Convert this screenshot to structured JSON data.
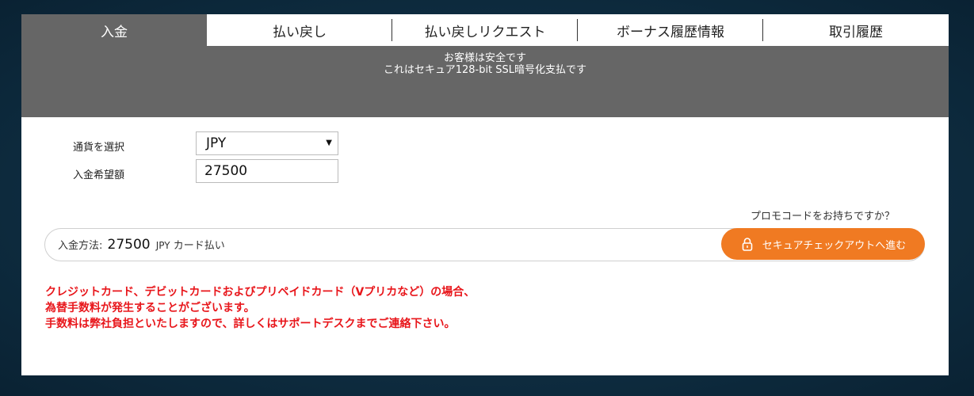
{
  "tabs": [
    {
      "label": "入金",
      "active": true
    },
    {
      "label": "払い戻し",
      "active": false
    },
    {
      "label": "払い戻しリクエスト",
      "active": false
    },
    {
      "label": "ボーナス履歴情報",
      "active": false
    },
    {
      "label": "取引履歴",
      "active": false
    }
  ],
  "banner": {
    "line1": "お客様は安全です",
    "line2": "これはセキュア128-bit SSL暗号化支払です"
  },
  "form": {
    "currency_label": "通貨を選択",
    "currency_value": "JPY",
    "amount_label": "入金希望額",
    "amount_value": "27500"
  },
  "promo_link": "プロモコードをお持ちですか？",
  "payment": {
    "prefix": "入金方法:",
    "amount": "27500",
    "currency": "JPY",
    "method": "カード払い"
  },
  "checkout_button": {
    "label": "セキュアチェックアウトへ進む",
    "icon": "lock-icon"
  },
  "notice": [
    "クレジットカード、デビットカードおよびプリペイドカード（Vプリカなど）の場合、",
    "為替手数料が発生することがございます。",
    "手数料は弊社負担といたしますので、詳しくはサポートデスクまでご連絡下さい。"
  ],
  "colors": {
    "background": "#0f2c3f",
    "tab_active": "#666666",
    "accent_orange": "#f07a22",
    "notice_red": "#e8161b"
  }
}
